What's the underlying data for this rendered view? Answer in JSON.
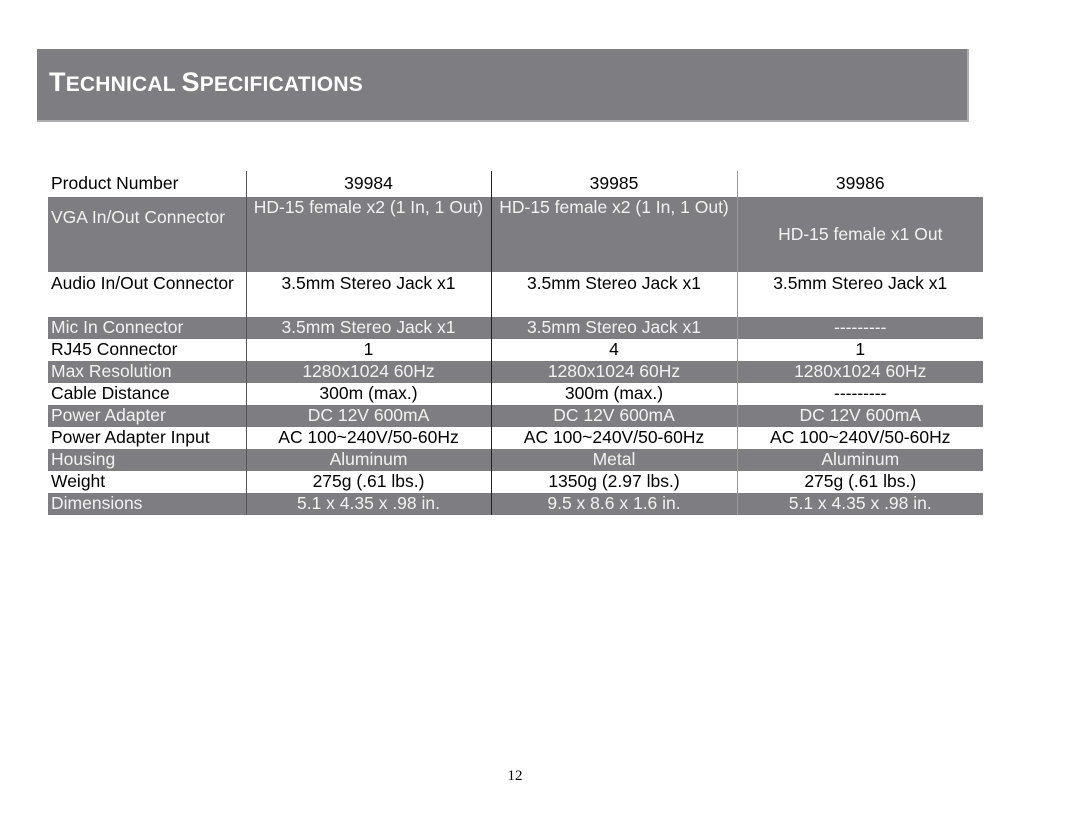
{
  "title": {
    "first_big": "T",
    "first_rest": "ECHNICAL ",
    "second_big": "S",
    "second_rest": "PECIFICATIONS",
    "full": "Technical Specifications"
  },
  "table": {
    "header": {
      "label": "Product Number",
      "values": [
        "39984",
        "39985",
        "39986"
      ]
    },
    "rows": [
      {
        "label": "VGA In/Out Connector",
        "values": [
          "HD-15 female x2 (1 In, 1 Out)",
          "HD-15 female x2 (1 In, 1 Out)",
          "HD-15 female x1 Out"
        ]
      },
      {
        "label": "Audio In/Out Connector",
        "values": [
          "3.5mm Stereo Jack x1",
          "3.5mm Stereo Jack x1",
          "3.5mm Stereo Jack x1"
        ]
      },
      {
        "label": "Mic In Connector",
        "values": [
          "3.5mm Stereo Jack x1",
          "3.5mm Stereo Jack x1",
          "---------"
        ]
      },
      {
        "label": "RJ45 Connector",
        "values": [
          "1",
          "4",
          "1"
        ]
      },
      {
        "label": "Max Resolution",
        "values": [
          "1280x1024 60Hz",
          "1280x1024 60Hz",
          "1280x1024 60Hz"
        ]
      },
      {
        "label": "Cable Distance",
        "values": [
          "300m (max.)",
          "300m (max.)",
          "---------"
        ]
      },
      {
        "label": "Power Adapter",
        "values": [
          "DC 12V 600mA",
          "DC 12V 600mA",
          "DC 12V 600mA"
        ]
      },
      {
        "label": "Power Adapter Input",
        "values": [
          "AC 100~240V/50-60Hz",
          "AC 100~240V/50-60Hz",
          "AC 100~240V/50-60Hz"
        ]
      },
      {
        "label": "Housing",
        "values": [
          "Aluminum",
          "Metal",
          "Aluminum"
        ]
      },
      {
        "label": "Weight",
        "values": [
          "275g (.61 lbs.)",
          "1350g (2.97 lbs.)",
          "275g (.61 lbs.)"
        ]
      },
      {
        "label": "Dimensions",
        "values": [
          "5.1 x 4.35 x .98 in.",
          "9.5 x 8.6 x 1.6 in.",
          "5.1 x 4.35 x .98 in."
        ]
      }
    ]
  },
  "page_number": "12",
  "colors": {
    "band_gray": "#7e7d81",
    "band_text": "#f2f2f2"
  }
}
